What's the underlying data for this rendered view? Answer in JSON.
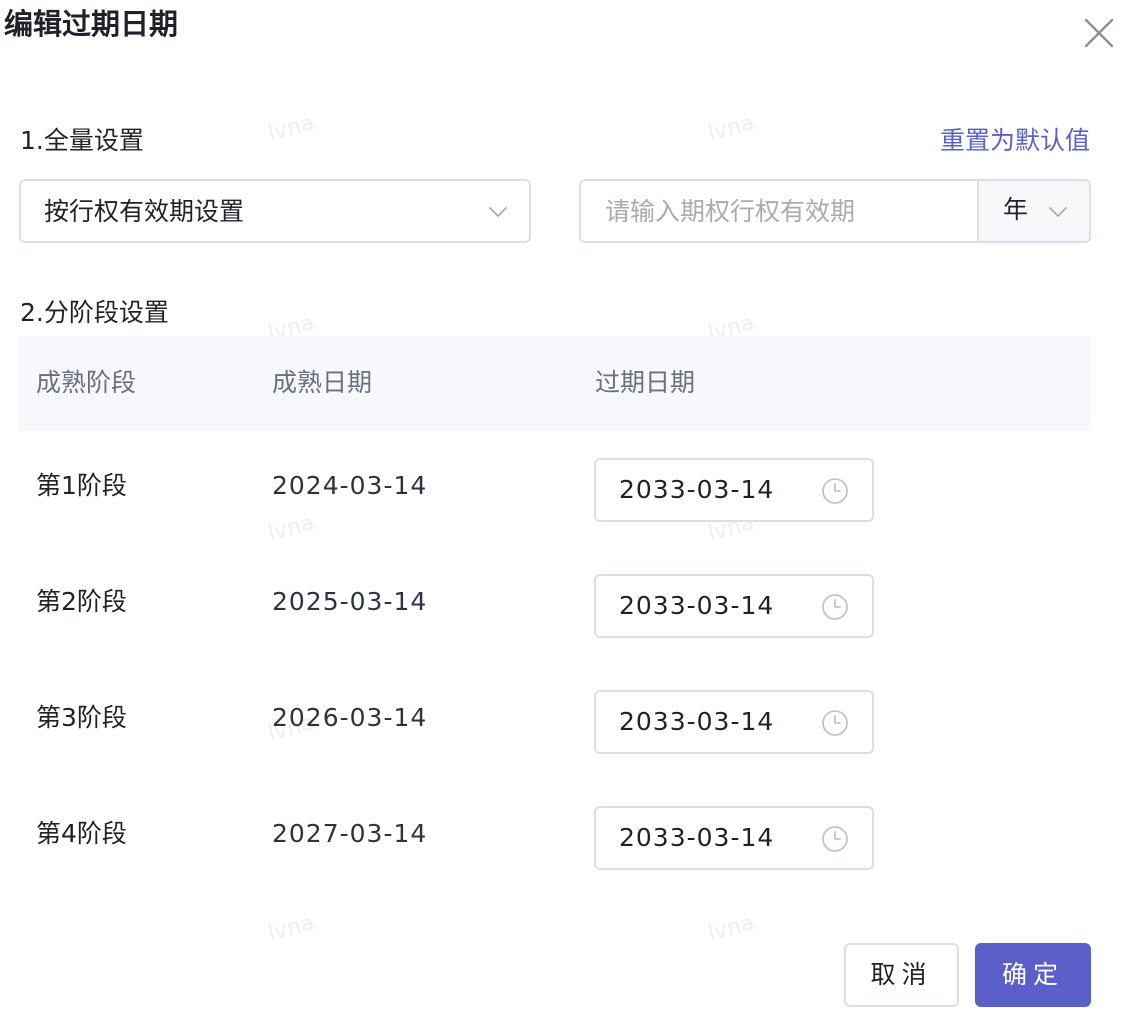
{
  "dialog": {
    "title": "编辑过期日期"
  },
  "section1": {
    "label": "1.全量设置",
    "reset_link": "重置为默认值",
    "mode_select_value": "按行权有效期设置",
    "period_input_value": "",
    "period_input_placeholder": "请输入期权行权有效期",
    "unit_select_value": "年"
  },
  "section2": {
    "label": "2.分阶段设置",
    "columns": [
      "成熟阶段",
      "成熟日期",
      "过期日期"
    ],
    "rows": [
      {
        "stage": "第1阶段",
        "mature_date": "2024-03-14",
        "expire_date": "2033-03-14"
      },
      {
        "stage": "第2阶段",
        "mature_date": "2025-03-14",
        "expire_date": "2033-03-14"
      },
      {
        "stage": "第3阶段",
        "mature_date": "2026-03-14",
        "expire_date": "2033-03-14"
      },
      {
        "stage": "第4阶段",
        "mature_date": "2027-03-14",
        "expire_date": "2033-03-14"
      }
    ]
  },
  "footer": {
    "cancel_label": "取消",
    "confirm_label": "确定"
  },
  "watermark": "lvna",
  "colors": {
    "accent": "#5a5fc9",
    "border": "#dcdfe6",
    "header_bg": "#f7f8fc",
    "placeholder": "#a8abb2"
  },
  "icons": {
    "close": "close-icon",
    "dropdown": "chevron-down-icon",
    "date_picker": "clock-icon"
  }
}
